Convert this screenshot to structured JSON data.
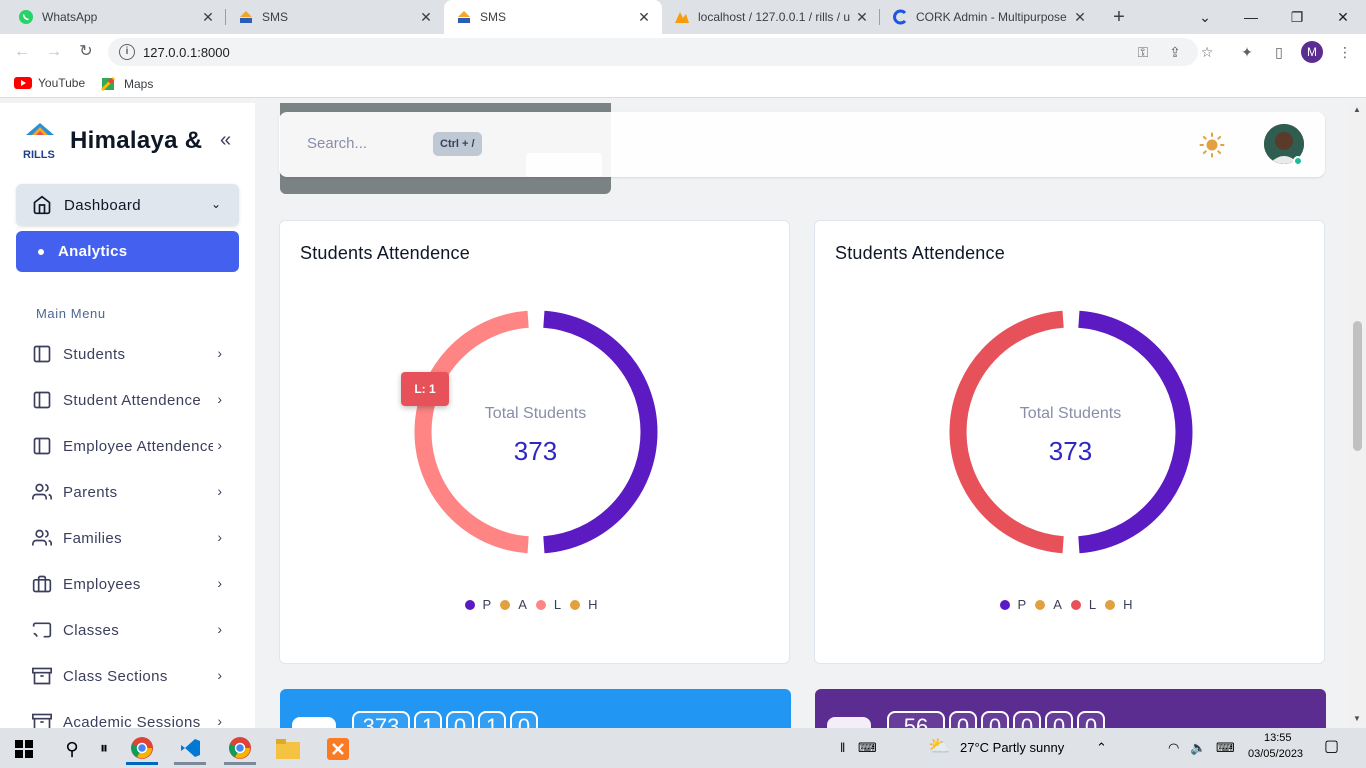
{
  "browser": {
    "tabs": [
      {
        "title": "WhatsApp",
        "active": false
      },
      {
        "title": "SMS",
        "active": false
      },
      {
        "title": "SMS",
        "active": true
      },
      {
        "title": "localhost / 127.0.0.1 / rills / u",
        "active": false
      },
      {
        "title": "CORK Admin - Multipurpose",
        "active": false
      }
    ],
    "url": "127.0.0.1:8000",
    "bookmarks": [
      "YouTube",
      "Maps"
    ],
    "profile_initial": "M"
  },
  "sidebar": {
    "brand": "Himalaya &",
    "logo_text": "RILLS",
    "dashboard": "Dashboard",
    "analytics": "Analytics",
    "section": "Main Menu",
    "items": [
      {
        "label": "Students",
        "icon": "book-icon"
      },
      {
        "label": "Student Attendence",
        "icon": "book-icon"
      },
      {
        "label": "Employee Attendence",
        "icon": "book-icon"
      },
      {
        "label": "Parents",
        "icon": "users-icon"
      },
      {
        "label": "Families",
        "icon": "users-icon"
      },
      {
        "label": "Employees",
        "icon": "briefcase-icon"
      },
      {
        "label": "Classes",
        "icon": "cast-icon"
      },
      {
        "label": "Class Sections",
        "icon": "archive-icon"
      },
      {
        "label": "Academic Sessions",
        "icon": "archive-icon"
      }
    ]
  },
  "header": {
    "search_placeholder": "Search...",
    "shortcut": "Ctrl + /"
  },
  "cards": [
    {
      "title": "Students Attendence",
      "center_label": "Total Students",
      "center_value": "373",
      "tooltip": "L: 1"
    },
    {
      "title": "Students Attendence",
      "center_label": "Total Students",
      "center_value": "373"
    }
  ],
  "chart_data": [
    {
      "type": "pie",
      "title": "Students Attendence",
      "categories": [
        "P",
        "A",
        "L",
        "H"
      ],
      "values": [
        1,
        0,
        1,
        0
      ],
      "colors": [
        "#5c1ac3",
        "#e2a03f",
        "#ff8585",
        "#e2a03f"
      ],
      "center_label": "Total Students",
      "center_value": "373",
      "legend": "bottom"
    },
    {
      "type": "pie",
      "title": "Students Attendence",
      "categories": [
        "P",
        "A",
        "L",
        "H"
      ],
      "values": [
        1,
        0,
        1,
        0
      ],
      "colors": [
        "#5c1ac3",
        "#e2a03f",
        "#e7515a",
        "#e2a03f"
      ],
      "center_label": "Total Students",
      "center_value": "373",
      "legend": "bottom"
    }
  ],
  "bottom_cards": [
    {
      "color": "#2196f3",
      "digits": [
        "373",
        "1",
        "0",
        "1",
        "0"
      ]
    },
    {
      "color": "#5c2d91",
      "digits": [
        "56",
        "0",
        "0",
        "0",
        "0",
        "0"
      ]
    }
  ],
  "taskbar": {
    "weather": "27°C  Partly sunny",
    "time": "13:55",
    "date": "03/05/2023"
  }
}
